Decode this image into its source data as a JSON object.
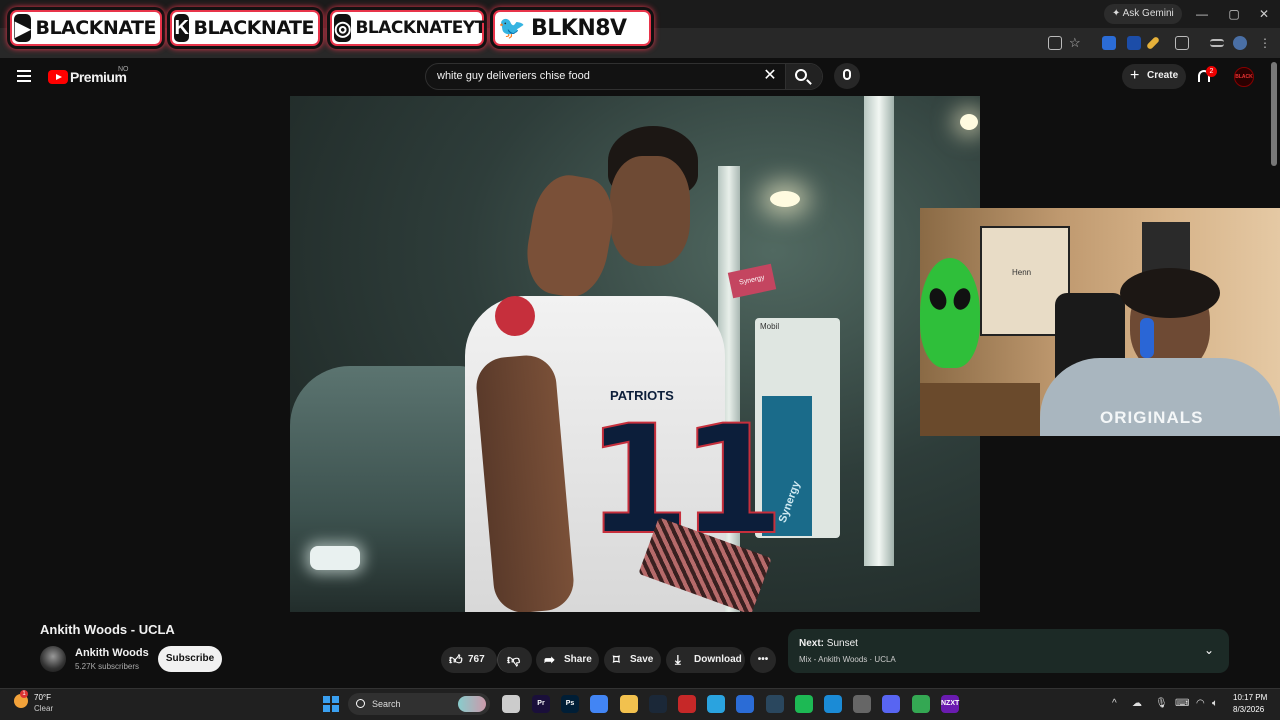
{
  "browser": {
    "gemini_label": "Ask Gemini",
    "window_controls": [
      "—",
      "▢",
      "✕"
    ]
  },
  "overlay": {
    "socials": [
      {
        "icon": "youtube-icon",
        "text": "BLACKNATE"
      },
      {
        "icon": "kick-icon",
        "text": "BLACKNATE"
      },
      {
        "icon": "instagram-icon",
        "text": "BLACKNATEYT"
      },
      {
        "icon": "twitter-icon",
        "text": "BLKN8V"
      }
    ],
    "accent": "#e8344a"
  },
  "youtube": {
    "logo_text": "Premium",
    "region": "NO",
    "search_value": "white guy deliveriers chise food",
    "create_label": "Create",
    "notification_count": "2",
    "avatar_text": "BLACK",
    "brand_color": "#ff0000"
  },
  "video": {
    "title": "Ankith Woods - UCLA",
    "channel": "Ankith Woods",
    "subscribers": "5.27K subscribers",
    "subscribe_label": "Subscribe",
    "like_count": "767",
    "share_label": "Share",
    "save_label": "Save",
    "download_label": "Download",
    "jersey_text": "PATRIOTS",
    "jersey_number": "11",
    "sign_text": "Mobil",
    "pump_text": "Synergy"
  },
  "webcam": {
    "shirt_text": "ORIGINALS",
    "bottle_text": "Henn"
  },
  "up_next": {
    "label": "Next:",
    "title": "Sunset",
    "subtitle": "Mix - Ankith Woods · UCLA"
  },
  "taskbar": {
    "temperature": "70°F",
    "condition": "Clear",
    "weather_badge": "1",
    "search_label": "Search",
    "time": "10:17 PM",
    "date": "8/3/2026",
    "apps": [
      {
        "name": "premiere-icon",
        "label": "Pr",
        "color": "#1a0f3a"
      },
      {
        "name": "photoshop-icon",
        "label": "Ps",
        "color": "#001e36"
      },
      {
        "name": "chrome-icon",
        "label": "",
        "color": "#4285f4"
      },
      {
        "name": "folder-icon",
        "label": "",
        "color": "#f2c14e"
      },
      {
        "name": "steam-icon",
        "label": "",
        "color": "#1b2838"
      },
      {
        "name": "app-red-icon",
        "label": "",
        "color": "#c62828"
      },
      {
        "name": "telegram-icon",
        "label": "",
        "color": "#2aa3df"
      },
      {
        "name": "app-blue-icon",
        "label": "",
        "color": "#2b6cd6"
      },
      {
        "name": "steam2-icon",
        "label": "",
        "color": "#2a475e"
      },
      {
        "name": "spotify-icon",
        "label": "",
        "color": "#1db954"
      },
      {
        "name": "edge-icon",
        "label": "",
        "color": "#1b8bd6"
      },
      {
        "name": "app-grey-icon",
        "label": "",
        "color": "#666666"
      },
      {
        "name": "discord-icon",
        "label": "",
        "color": "#5865f2"
      },
      {
        "name": "chrome2-icon",
        "label": "",
        "color": "#34a853"
      },
      {
        "name": "nzxt-icon",
        "label": "NZXT",
        "color": "#6a1bb0"
      }
    ]
  }
}
